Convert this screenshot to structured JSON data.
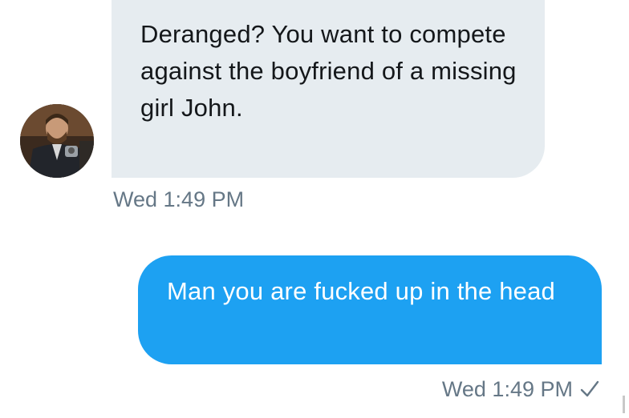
{
  "conversation": {
    "received_message": {
      "text": "Deranged? You want to compete against the boyfriend of a missing girl John.",
      "timestamp": "Wed 1:49 PM"
    },
    "sent_message": {
      "text": "Man you are fucked up in the head",
      "timestamp": "Wed 1:49 PM",
      "status_icon": "check-icon"
    }
  },
  "colors": {
    "received_bubble": "#e6ecf0",
    "sent_bubble": "#1da1f2",
    "timestamp": "#657786",
    "received_text": "#14171a",
    "sent_text": "#ffffff"
  }
}
